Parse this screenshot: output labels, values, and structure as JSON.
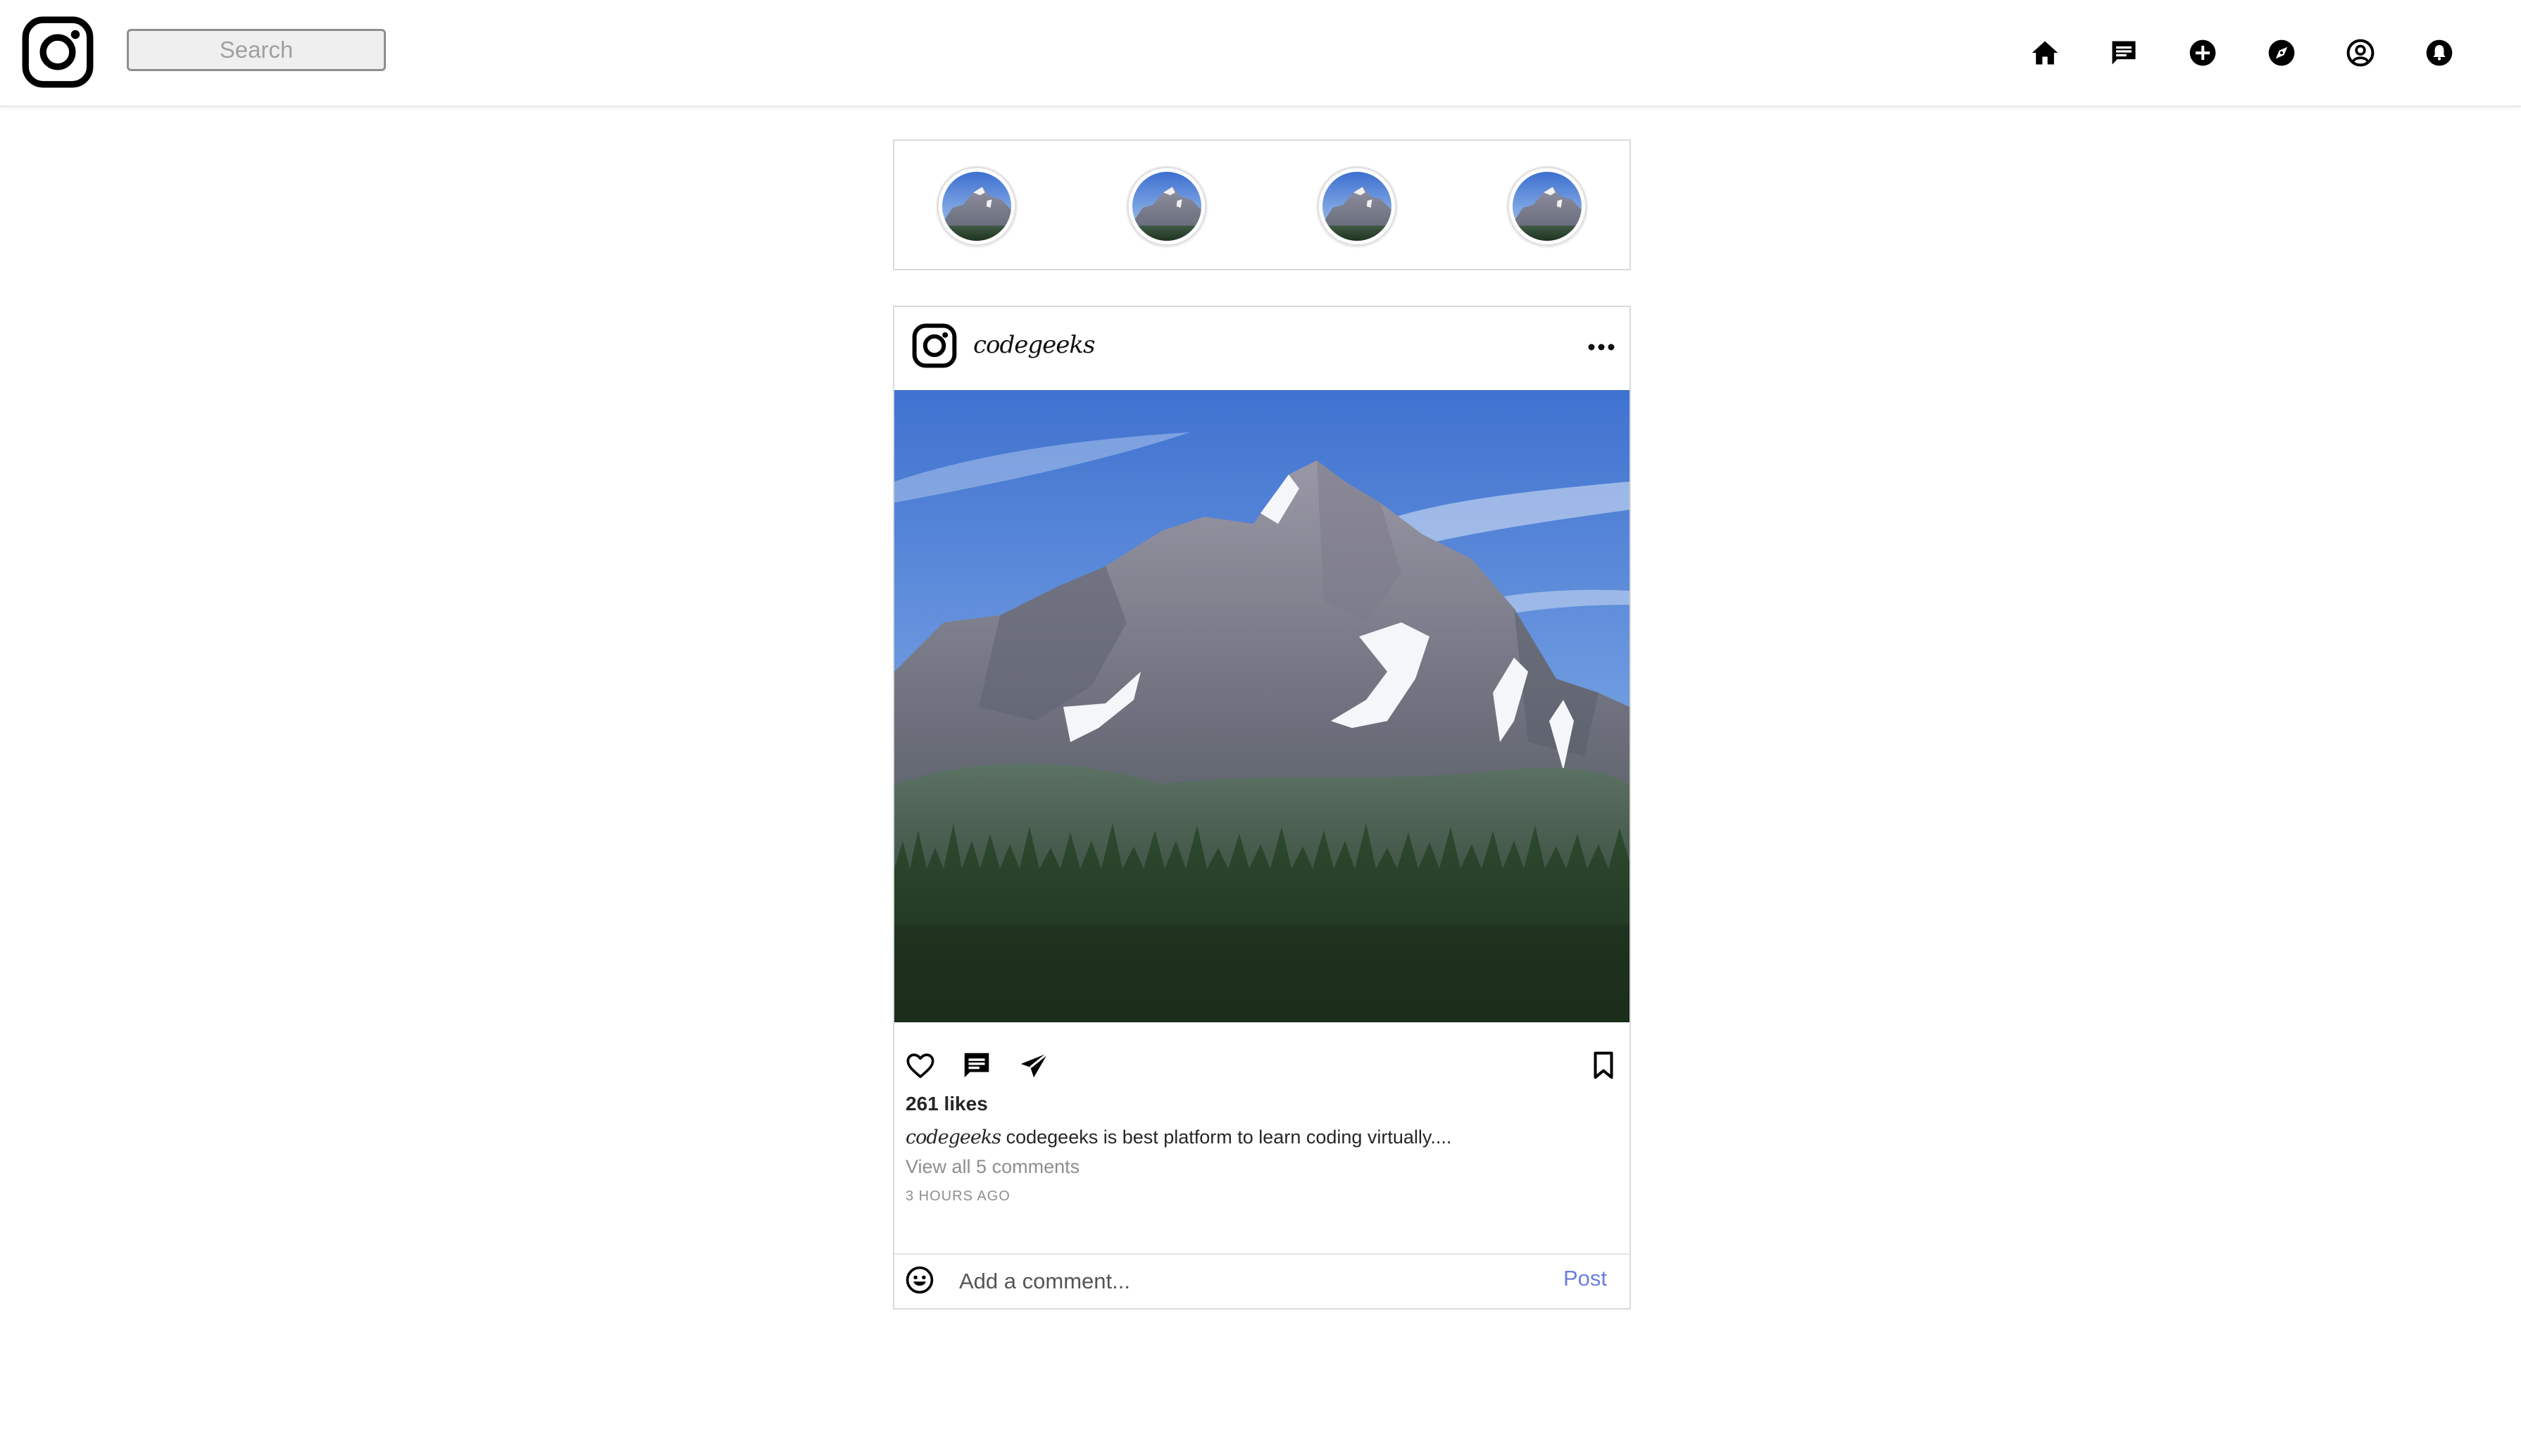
{
  "app": {
    "brand_color": "#000000",
    "link_color": "#6b7fe0"
  },
  "search": {
    "placeholder": "Search"
  },
  "nav": {
    "icons": [
      "home-icon",
      "messages-icon",
      "new-post-icon",
      "explore-icon",
      "profile-icon",
      "notifications-icon"
    ]
  },
  "stories": {
    "count": 4
  },
  "post": {
    "username": "codegeeks",
    "likes": "261 likes",
    "caption_user": "codegeeks",
    "caption_text": " codegeeks is best platform to learn coding virtually....",
    "view_comments": "View all 5 comments",
    "time": "3 HOURS AGO",
    "comment_placeholder": "Add a comment...",
    "post_label": "Post"
  }
}
